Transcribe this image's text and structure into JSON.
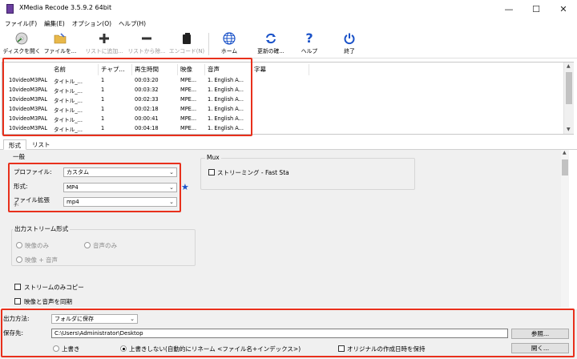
{
  "window": {
    "title": "XMedia Recode 3.5.9.2 64bit",
    "minimize": "—",
    "maximize": "☐",
    "close": "✕"
  },
  "menu": [
    "ファイル(F)",
    "編集(E)",
    "オプション(O)",
    "ヘルプ(H)"
  ],
  "toolbar": [
    {
      "label": "ディスクを開く",
      "icon": "disc-icon",
      "enabled": true
    },
    {
      "label": "ファイルを...",
      "icon": "folder-icon",
      "enabled": true
    },
    {
      "label": "リストに追加...",
      "icon": "plus-icon",
      "enabled": false
    },
    {
      "label": "リストから除...",
      "icon": "minus-icon",
      "enabled": false
    },
    {
      "label": "エンコード(N)",
      "icon": "encode-icon",
      "enabled": false
    },
    {
      "label": "ホーム",
      "icon": "globe-icon",
      "enabled": true
    },
    {
      "label": "更新の確...",
      "icon": "refresh-icon",
      "enabled": true
    },
    {
      "label": "ヘルプ",
      "icon": "help-icon",
      "enabled": true
    },
    {
      "label": "終了",
      "icon": "power-icon",
      "enabled": true
    }
  ],
  "table": {
    "columns": [
      "名前",
      "チャプ...",
      "再生時間",
      "映像",
      "音声",
      "字幕"
    ],
    "rows": [
      [
        "10videoM3PAL",
        "タイトル_...",
        "1",
        "00:03:20",
        "MPE...",
        "1. English A..."
      ],
      [
        "10videoM3PAL",
        "タイトル_...",
        "1",
        "00:03:32",
        "MPE...",
        "1. English A..."
      ],
      [
        "10videoM3PAL",
        "タイトル_...",
        "1",
        "00:02:33",
        "MPE...",
        "1. English A..."
      ],
      [
        "10videoM3PAL",
        "タイトル_...",
        "1",
        "00:02:18",
        "MPE...",
        "1. English A..."
      ],
      [
        "10videoM3PAL",
        "タイトル_...",
        "1",
        "00:00:41",
        "MPE...",
        "1. English A..."
      ],
      [
        "10videoM3PAL",
        "タイトル_...",
        "1",
        "00:04:18",
        "MPE...",
        "1. English A..."
      ]
    ]
  },
  "tabs": [
    "形式",
    "リスト"
  ],
  "general": {
    "group_title": "一般",
    "profile_label": "プロファイル:",
    "profile_value": "カスタム",
    "format_label": "形式:",
    "format_value": "MP4",
    "ext_label": "ファイル拡張",
    "ext_label2": "子:",
    "ext_value": "mp4"
  },
  "mux": {
    "group_title": "Mux",
    "streaming_label": "ストリーミング - Fast Sta"
  },
  "output_stream": {
    "group_title": "出力ストリーム形式",
    "video_only": "映像のみ",
    "audio_only": "音声のみ",
    "video_audio": "映像 + 音声"
  },
  "stream_copy": "ストリームのみコピー",
  "sync_av": "映像と音声を同期",
  "output": {
    "method_label": "出力方法:",
    "method_value": "フォルダに保存",
    "dest_label": "保存先:",
    "dest_value": "C:\\Users\\Administrator\\Desktop",
    "browse": "参照...",
    "overwrite": "上書き",
    "no_overwrite": "上書きしない(自動的にリネーム <ファイル名+インデックス>)",
    "keep_date": "オリジナルの作成日時を保持",
    "open": "開く..."
  },
  "colors": {
    "highlight": "#e8301c",
    "accent": "#1a52c8"
  }
}
